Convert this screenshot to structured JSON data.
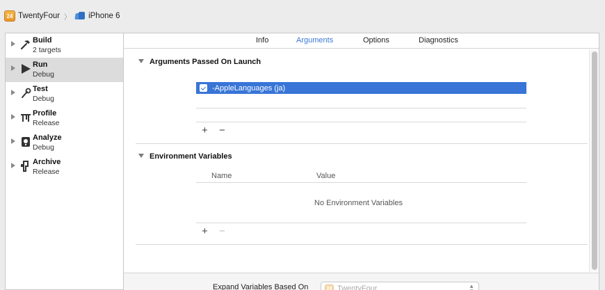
{
  "breadcrumb": {
    "project": "TwentyFour",
    "project_icon": "24",
    "separator": "〉",
    "device": "iPhone 6"
  },
  "sidebar": {
    "items": [
      {
        "name": "Build",
        "sub": "2 targets",
        "icon": "hammer-icon",
        "selected": false
      },
      {
        "name": "Run",
        "sub": "Debug",
        "icon": "play-icon",
        "selected": true
      },
      {
        "name": "Test",
        "sub": "Debug",
        "icon": "wrench-icon",
        "selected": false
      },
      {
        "name": "Profile",
        "sub": "Release",
        "icon": "instruments-icon",
        "selected": false
      },
      {
        "name": "Analyze",
        "sub": "Debug",
        "icon": "analyze-icon",
        "selected": false
      },
      {
        "name": "Archive",
        "sub": "Release",
        "icon": "archive-icon",
        "selected": false
      }
    ]
  },
  "tabs": [
    {
      "label": "Info",
      "active": false
    },
    {
      "label": "Arguments",
      "active": true
    },
    {
      "label": "Options",
      "active": false
    },
    {
      "label": "Diagnostics",
      "active": false
    }
  ],
  "arguments": {
    "title": "Arguments Passed On Launch",
    "rows": [
      {
        "enabled": true,
        "value": "-AppleLanguages (ja)"
      }
    ],
    "add": "+",
    "remove": "−"
  },
  "environment": {
    "title": "Environment Variables",
    "columns": [
      "Name",
      "Value"
    ],
    "empty_message": "No Environment Variables",
    "add": "+",
    "remove": "−"
  },
  "footer": {
    "expand_label": "Expand Variables Based On",
    "selected_value": "TwentyFour",
    "selected_icon": "24"
  },
  "colors": {
    "accent": "#3875d7",
    "active_tab": "#3a78d6",
    "selection_gray": "#dcdcdc"
  }
}
